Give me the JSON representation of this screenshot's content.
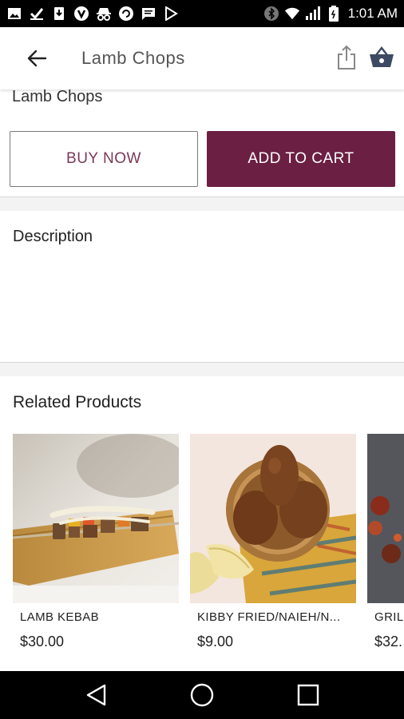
{
  "status_bar": {
    "time": "1:01 AM",
    "icons": [
      "image-icon",
      "check-icon",
      "download-icon",
      "vpn-icon",
      "incognito-icon",
      "sync-icon",
      "message-icon",
      "play-store-icon",
      "bluetooth-icon",
      "wifi-icon",
      "signal-icon",
      "battery-icon"
    ]
  },
  "app_bar": {
    "title": "Lamb Chops",
    "back_icon": "arrow-back-icon",
    "share_icon": "share-icon",
    "cart_icon": "basket-icon"
  },
  "product": {
    "name": "Lamb Chops",
    "buy_now_label": "BUY NOW",
    "add_to_cart_label": "ADD TO CART"
  },
  "description": {
    "title": "Description"
  },
  "related": {
    "title": "Related Products",
    "items": [
      {
        "name": "LAMB KEBAB",
        "price": "$30.00"
      },
      {
        "name": "KIBBY FRIED/NAIEH/N...",
        "price": "$9.00"
      },
      {
        "name": "GRIL",
        "price": "$32."
      }
    ]
  },
  "colors": {
    "accent": "#6b1f42",
    "buy_now_text": "#7a3a55"
  },
  "nav_bar": {
    "icons": [
      "back-triangle-icon",
      "home-circle-icon",
      "recents-square-icon"
    ]
  }
}
